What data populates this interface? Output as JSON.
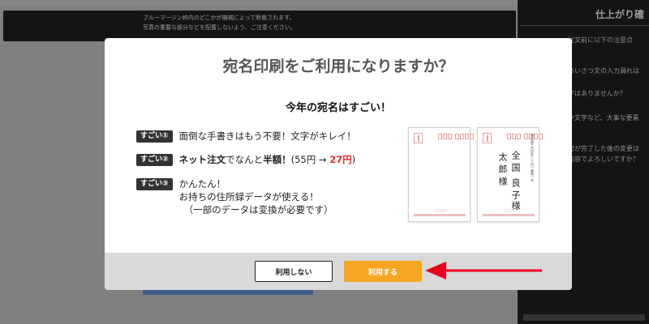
{
  "background": {
    "notice_lines": [
      "ブルーマージン枠内のどこかが機械によって断裁されます。",
      "写真の重要な部分などを配置しないよう、ご注意ください。"
    ],
    "sidebar": {
      "title": "仕上がり確",
      "lines": [
        "注文前に以下の注意点",
        "あいさつ文の入力漏れは",
        "字はありませんか？",
        "や文字など、大事な要素",
        "付が完了した後の変更は",
        "内容でよろしいですか？"
      ]
    }
  },
  "modal": {
    "title": "宛名印刷をご利用になりますか？",
    "subtitle": "今年の宛名はすごい！",
    "features": [
      {
        "badge": "すごい①",
        "text": "面倒な手書きはもう不要！文字がキレイ！"
      },
      {
        "badge": "すごい②",
        "text_bold": "ネット注文",
        "text_mid": "でなんと",
        "text_bold2": "半額！",
        "price_open": "(55円 → ",
        "price_new": "27円",
        "price_close": ")"
      },
      {
        "badge": "すごい③",
        "lines": [
          "かんたん！",
          "お持ちの住所録データが使える！",
          "（一部のデータは変換が必要です）"
        ]
      }
    ],
    "postcard": {
      "name_line1": "全国",
      "name_line2": "良子",
      "name_line3": "太郎",
      "name_line4": "様",
      "name_line5": "様",
      "address_tiny": "東京都千代田区一丁目一番地一号",
      "zip_digits": "1000001"
    },
    "buttons": {
      "no_label": "利用しない",
      "yes_label": "利用する"
    }
  },
  "colors": {
    "accent_orange": "#f6a623",
    "annotation_red": "#e8001c",
    "price_red": "#e82c2c"
  }
}
